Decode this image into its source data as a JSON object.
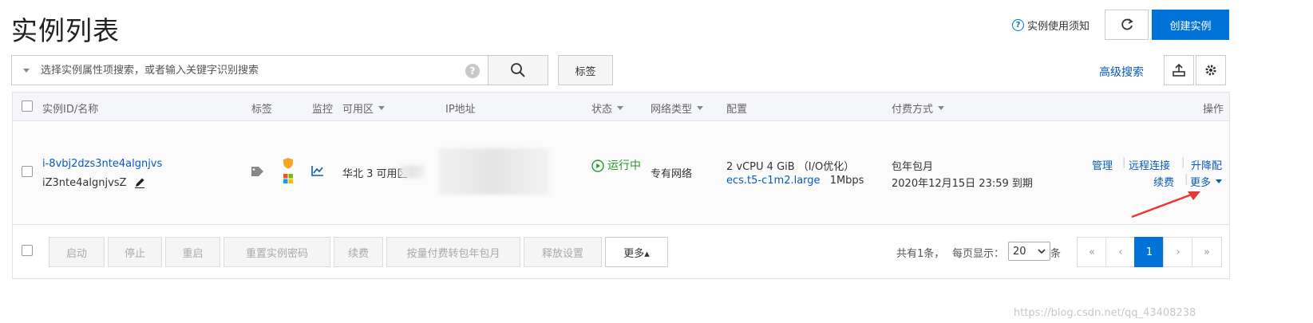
{
  "header": {
    "title": "实例列表",
    "help_label": "实例使用须知",
    "create_label": "创建实例"
  },
  "toolbar": {
    "search_placeholder": "选择实例属性项搜索，或者输入关键字识别搜索",
    "tag_label": "标签",
    "advanced_search_label": "高级搜索"
  },
  "table": {
    "columns": {
      "id_name": "实例ID/名称",
      "tags": "标签",
      "monitor": "监控",
      "zone": "可用区",
      "ip": "IP地址",
      "status": "状态",
      "network": "网络类型",
      "config": "配置",
      "billing": "付费方式",
      "actions": "操作"
    },
    "rows": [
      {
        "instance_id": "i-8vbj2dzs3nte4algnjvs",
        "instance_name": "iZ3nte4algnjvsZ",
        "zone": "华北 3 可用区",
        "status": "运行中",
        "network": "专有网络",
        "config_spec": "2 vCPU 4 GiB （I/O优化）",
        "config_type": "ecs.t5-c1m2.large",
        "config_bandwidth": "1Mbps",
        "billing_type": "包年包月",
        "billing_expire": "2020年12月15日 23:59 到期",
        "actions": {
          "manage": "管理",
          "remote": "远程连接",
          "upgrade": "升降配",
          "renew": "续费",
          "more": "更多"
        }
      }
    ]
  },
  "footer": {
    "buttons": {
      "start": "启动",
      "stop": "停止",
      "restart": "重启",
      "reset_password": "重置实例密码",
      "renew": "续费",
      "convert": "按量付费转包年包月",
      "release": "释放设置",
      "more": "更多▴"
    },
    "pagination": {
      "total_text": "共有1条，",
      "page_size_label": "每页显示：",
      "page_size_value": "20",
      "page_size_suffix": "条",
      "first": "«",
      "prev": "‹",
      "current": "1",
      "next": "›",
      "last": "»"
    }
  },
  "watermark": "https://blog.csdn.net/qq_43408238",
  "colors": {
    "primary": "#0073d8",
    "link": "#0a5bb8",
    "status_running": "#2a9a2a",
    "annotation_arrow": "#e53935"
  }
}
